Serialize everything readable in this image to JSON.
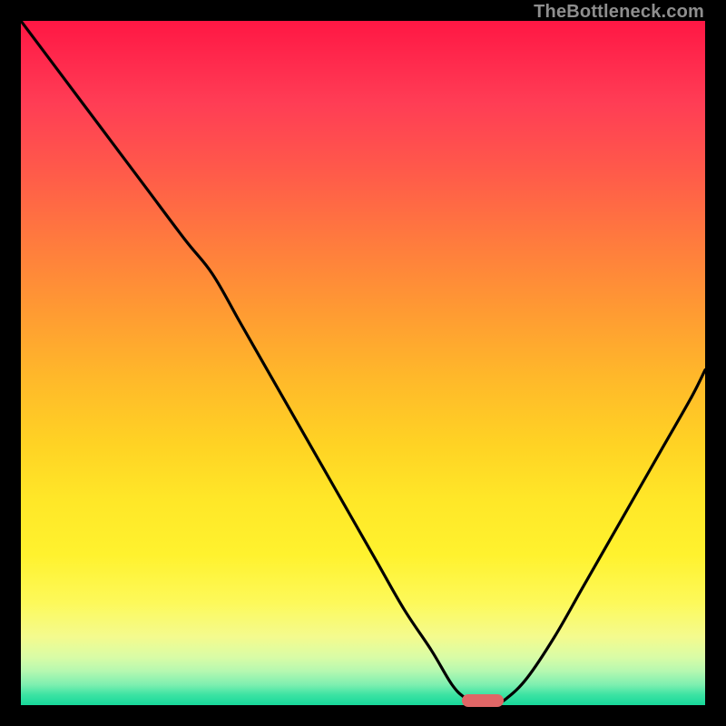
{
  "watermark": "TheBottleneck.com",
  "colors": {
    "frame": "#000000",
    "curve": "#000000",
    "marker": "#e06666"
  },
  "chart_data": {
    "type": "line",
    "title": "",
    "xlabel": "",
    "ylabel": "",
    "xlim": [
      0,
      100
    ],
    "ylim": [
      0,
      100
    ],
    "grid": false,
    "legend": false,
    "series": [
      {
        "name": "bottleneck-curve",
        "x": [
          0,
          6,
          12,
          18,
          24,
          28,
          32,
          36,
          40,
          44,
          48,
          52,
          56,
          60,
          63,
          65,
          67,
          69,
          71,
          74,
          78,
          82,
          86,
          90,
          94,
          98,
          100
        ],
        "values": [
          100,
          92,
          84,
          76,
          68,
          63,
          56,
          49,
          42,
          35,
          28,
          21,
          14,
          8,
          3,
          1,
          0,
          0,
          1,
          4,
          10,
          17,
          24,
          31,
          38,
          45,
          49
        ]
      }
    ],
    "marker": {
      "x_center": 67.5,
      "width_pct": 6,
      "y": 0
    },
    "background_gradient": [
      {
        "stop": 0,
        "color": "#ff1744"
      },
      {
        "stop": 0.5,
        "color": "#ffb82a"
      },
      {
        "stop": 0.82,
        "color": "#fff22e"
      },
      {
        "stop": 1.0,
        "color": "#17d89a"
      }
    ]
  }
}
